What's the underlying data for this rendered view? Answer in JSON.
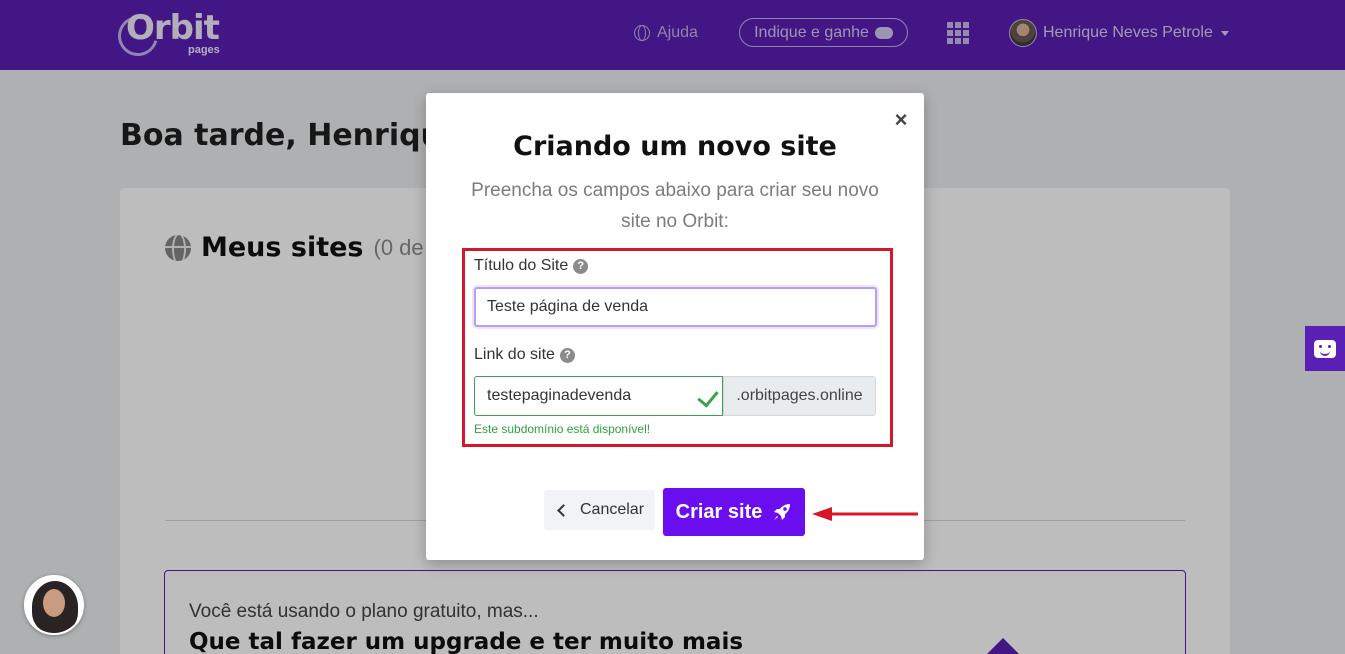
{
  "header": {
    "logo_text": "Orbit",
    "logo_sub": "pages",
    "help_label": "Ajuda",
    "refer_label": "Indique e ganhe",
    "user_name": "Henrique Neves Petrole"
  },
  "page": {
    "greeting": "Boa tarde, Henriqu",
    "sites_title": "Meus sites",
    "sites_count": "(0 de",
    "upgrade_small": "Você está usando o plano gratuito, mas...",
    "upgrade_big": "Que tal fazer um upgrade e ter muito mais"
  },
  "modal": {
    "close": "×",
    "title": "Criando um novo site",
    "subtitle": "Preencha os campos abaixo para criar seu novo site no Orbit:",
    "title_label": "Título do Site",
    "title_value": "Teste página de venda",
    "link_label": "Link do site",
    "link_value": "testepaginadevenda",
    "domain_suffix": ".orbitpages.online",
    "availability": "Este subdomínio está disponível!",
    "cancel_label": "Cancelar",
    "create_label": "Criar site"
  },
  "colors": {
    "brand": "#5a1fb4",
    "primary_button": "#6a0ef0",
    "success": "#3aa14a",
    "highlight": "#d4172b"
  }
}
